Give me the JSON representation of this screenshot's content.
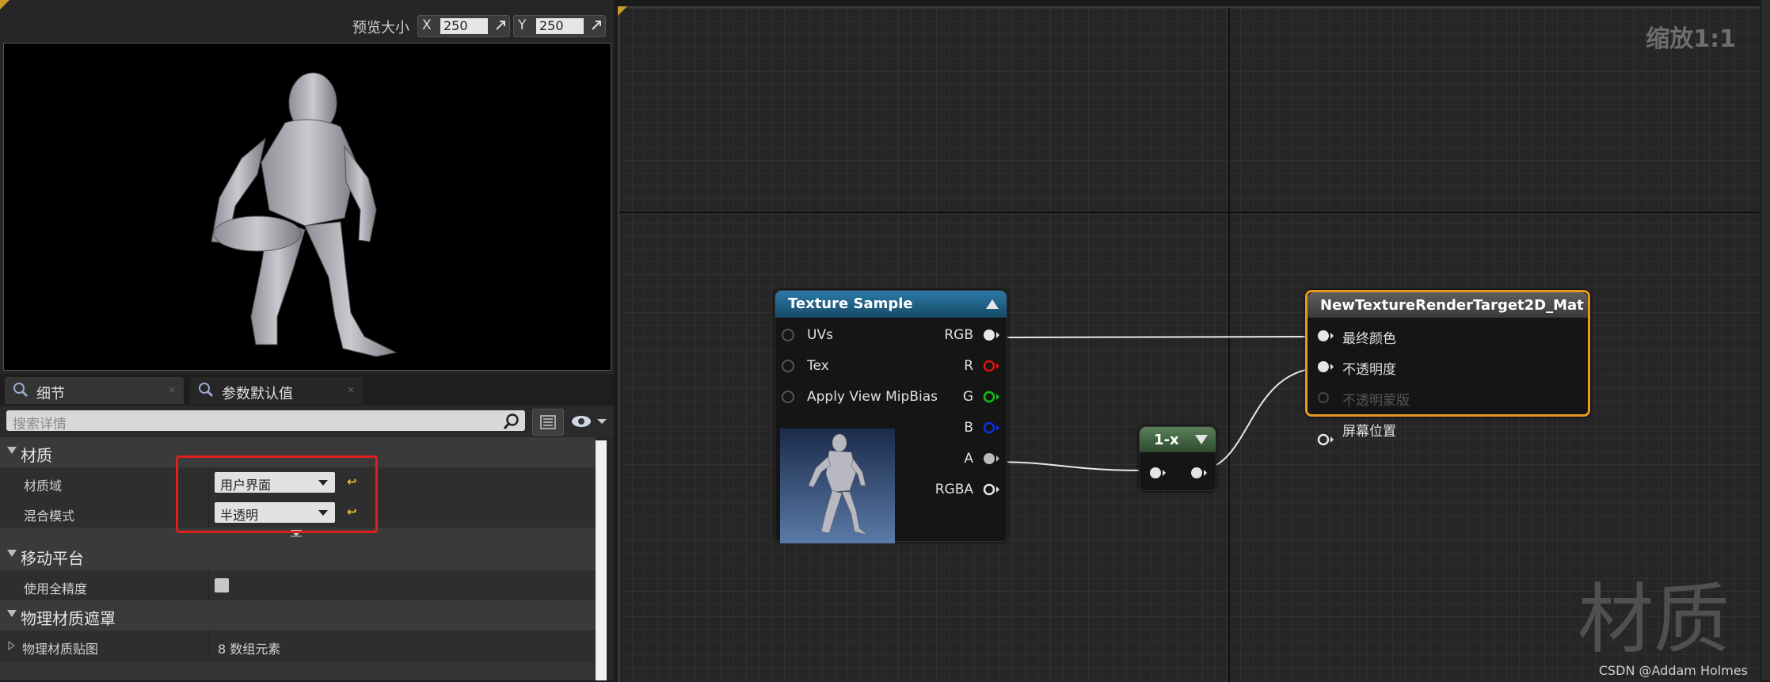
{
  "preview": {
    "label": "预览大小",
    "x_label": "X",
    "x_value": "250",
    "y_label": "Y",
    "y_value": "250"
  },
  "tabs": [
    {
      "label": "细节"
    },
    {
      "label": "参数默认值"
    }
  ],
  "search": {
    "placeholder": "搜索详情"
  },
  "details": {
    "material": {
      "title": "材质",
      "rows": [
        {
          "label": "材质域",
          "value": "用户界面"
        },
        {
          "label": "混合模式",
          "value": "半透明"
        }
      ]
    },
    "mobile": {
      "title": "移动平台",
      "rows": [
        {
          "label": "使用全精度",
          "checked": false
        }
      ]
    },
    "physical": {
      "title": "物理材质遮罩",
      "rows": [
        {
          "label": "物理材质贴图",
          "value": "8 数组元素"
        }
      ]
    }
  },
  "graph": {
    "zoom": "缩放1:1",
    "watermark": "材质",
    "credit": "CSDN @Addam Holmes",
    "texture_node": {
      "title": "Texture Sample",
      "inputs": [
        "UVs",
        "Tex",
        "Apply View MipBias"
      ],
      "outputs": [
        "RGB",
        "R",
        "G",
        "B",
        "A",
        "RGBA"
      ]
    },
    "oneminus_node": {
      "title": "1-x"
    },
    "result_node": {
      "title": "NewTextureRenderTarget2D_Mat",
      "inputs": [
        "最终颜色",
        "不透明度",
        "不透明蒙版",
        "屏幕位置"
      ]
    }
  },
  "colors": {
    "texture_header": "#1f5f86",
    "oneminus_header": "#3e5e3e",
    "result_header": "#4a4a4a",
    "result_border": "#e8981e",
    "highlight": "#e01e1e",
    "pin_r": "#e01010",
    "pin_g": "#10c010",
    "pin_b": "#1030e0"
  }
}
